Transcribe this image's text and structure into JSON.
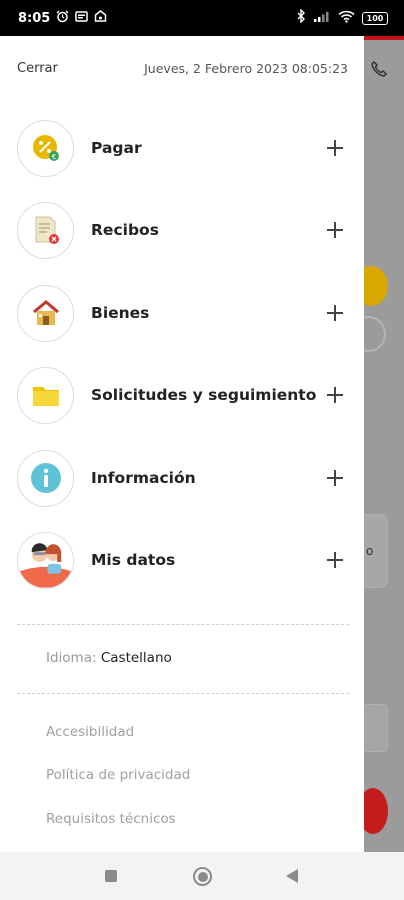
{
  "status_bar": {
    "time": "8:05",
    "battery": "100",
    "icons": [
      "alarm-icon",
      "notification-icon",
      "app-icon",
      "bluetooth-icon",
      "signal-icon",
      "wifi-icon",
      "battery-icon"
    ]
  },
  "drawer": {
    "close_label": "Cerrar",
    "datetime": "Jueves, 2 Febrero 2023 08:05:23",
    "menu": [
      {
        "label": "Pagar",
        "icon": "pay-icon"
      },
      {
        "label": "Recibos",
        "icon": "receipt-icon"
      },
      {
        "label": "Bienes",
        "icon": "house-icon"
      },
      {
        "label": "Solicitudes y seguimiento",
        "icon": "folder-icon"
      },
      {
        "label": "Información",
        "icon": "info-icon"
      },
      {
        "label": "Mis datos",
        "icon": "user-data-icon"
      }
    ],
    "language": {
      "label": "Idioma:",
      "value": "Castellano"
    },
    "footer_links": [
      "Accesibilidad",
      "Política de privacidad",
      "Requisitos técnicos"
    ]
  },
  "background": {
    "phone_icon": "phone-icon",
    "partial_text": "o"
  },
  "colors": {
    "accent_red": "#c0151b",
    "yellow": "#e8b800",
    "info_teal": "#5ec3d6"
  }
}
